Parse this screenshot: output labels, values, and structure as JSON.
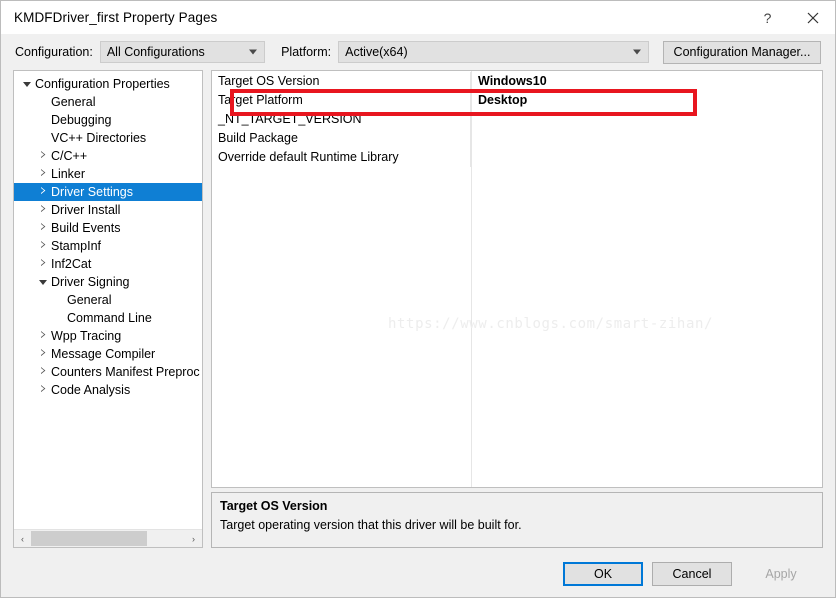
{
  "window": {
    "title": "KMDFDriver_first Property Pages",
    "help_icon": "?",
    "close_icon": "close-icon"
  },
  "config_bar": {
    "configuration_label": "Configuration:",
    "configuration_value": "All Configurations",
    "platform_label": "Platform:",
    "platform_value": "Active(x64)",
    "manager_button": "Configuration Manager..."
  },
  "tree": {
    "items": [
      {
        "label": "Configuration Properties",
        "indent": 0,
        "expander": "expanded",
        "selected": false
      },
      {
        "label": "General",
        "indent": 1,
        "expander": "none",
        "selected": false
      },
      {
        "label": "Debugging",
        "indent": 1,
        "expander": "none",
        "selected": false
      },
      {
        "label": "VC++ Directories",
        "indent": 1,
        "expander": "none",
        "selected": false
      },
      {
        "label": "C/C++",
        "indent": 1,
        "expander": "collapsed",
        "selected": false
      },
      {
        "label": "Linker",
        "indent": 1,
        "expander": "collapsed",
        "selected": false
      },
      {
        "label": "Driver Settings",
        "indent": 1,
        "expander": "collapsed",
        "selected": true
      },
      {
        "label": "Driver Install",
        "indent": 1,
        "expander": "collapsed",
        "selected": false
      },
      {
        "label": "Build Events",
        "indent": 1,
        "expander": "collapsed",
        "selected": false
      },
      {
        "label": "StampInf",
        "indent": 1,
        "expander": "collapsed",
        "selected": false
      },
      {
        "label": "Inf2Cat",
        "indent": 1,
        "expander": "collapsed",
        "selected": false
      },
      {
        "label": "Driver Signing",
        "indent": 1,
        "expander": "expanded",
        "selected": false
      },
      {
        "label": "General",
        "indent": 2,
        "expander": "none",
        "selected": false
      },
      {
        "label": "Command Line",
        "indent": 2,
        "expander": "none",
        "selected": false
      },
      {
        "label": "Wpp Tracing",
        "indent": 1,
        "expander": "collapsed",
        "selected": false
      },
      {
        "label": "Message Compiler",
        "indent": 1,
        "expander": "collapsed",
        "selected": false
      },
      {
        "label": "Counters Manifest Preproc",
        "indent": 1,
        "expander": "collapsed",
        "selected": false
      },
      {
        "label": "Code Analysis",
        "indent": 1,
        "expander": "collapsed",
        "selected": false
      }
    ],
    "scrollbar": {
      "left_arrow": "‹",
      "right_arrow": "›"
    }
  },
  "property_grid": {
    "rows": [
      {
        "name": "Target OS Version",
        "value": "Windows10"
      },
      {
        "name": "Target Platform",
        "value": "Desktop"
      },
      {
        "name": "_NT_TARGET_VERSION",
        "value": ""
      },
      {
        "name": "Build Package",
        "value": ""
      },
      {
        "name": "Override default Runtime Library",
        "value": ""
      }
    ],
    "highlight_color": "#e8161f",
    "highlighted_row": "Target Platform"
  },
  "watermark": {
    "text": "https://www.cnblogs.com/smart-zihan/"
  },
  "description": {
    "title": "Target OS Version",
    "body": "Target operating version that this driver will be built for."
  },
  "footer": {
    "ok": "OK",
    "cancel": "Cancel",
    "apply": "Apply"
  }
}
